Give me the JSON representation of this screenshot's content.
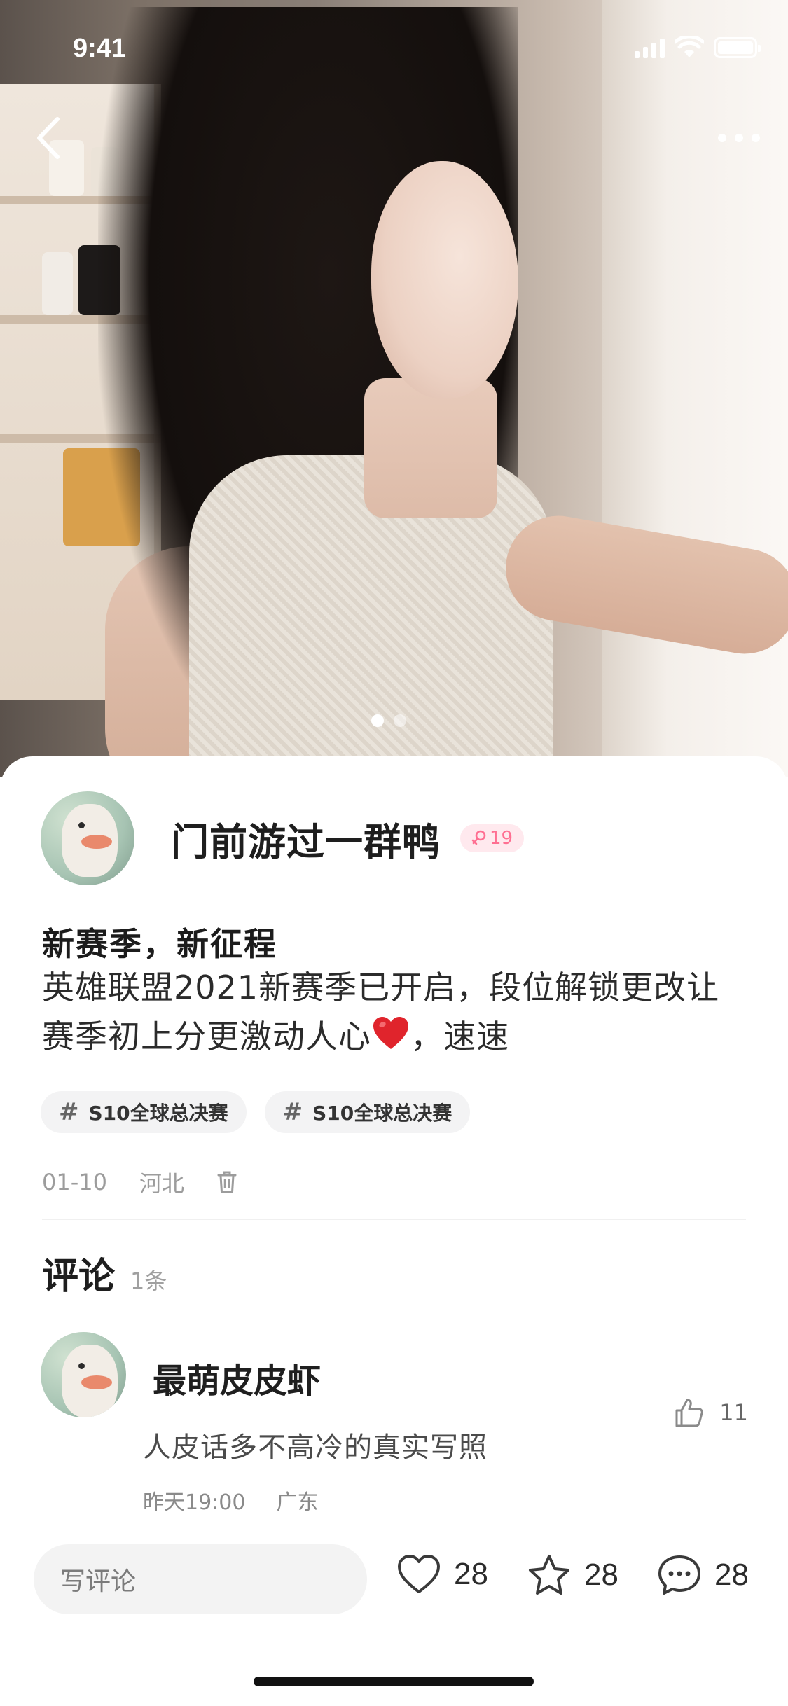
{
  "status_bar": {
    "time": "9:41"
  },
  "nav": {
    "back_icon": "chevron-left-icon",
    "more_icon": "more-dots-icon"
  },
  "carousel": {
    "total": 2,
    "active_index": 0
  },
  "post": {
    "author": {
      "name": "门前游过一群鸭",
      "level": "19",
      "gender_icon": "female-icon"
    },
    "title": "新赛季，新征程",
    "body_line1": "英雄联盟2021新赛季已开启，段位解锁更改让",
    "body_line2_pre": "赛季初上分更激动人心",
    "body_emoji": "red-heart-emoji",
    "body_line2_post": "，速速",
    "tags": [
      {
        "hash": "#",
        "label": "S10全球总决赛"
      },
      {
        "hash": "#",
        "label": "S10全球总决赛"
      }
    ],
    "date": "01-10",
    "location": "河北",
    "delete_icon": "trash-icon"
  },
  "comments": {
    "title": "评论",
    "count": "1条",
    "items": [
      {
        "name": "最萌皮皮虾",
        "text": "人皮话多不高冷的真实写照",
        "time": "昨天19:00",
        "location": "广东",
        "likes": "11"
      }
    ]
  },
  "bottom_bar": {
    "input_placeholder": "写评论",
    "like_count": "28",
    "favorite_count": "28",
    "comment_count": "28"
  },
  "colors": {
    "badge_bg": "#ffe9ee",
    "badge_fg": "#ff6f92",
    "heart": "#e0242c"
  }
}
